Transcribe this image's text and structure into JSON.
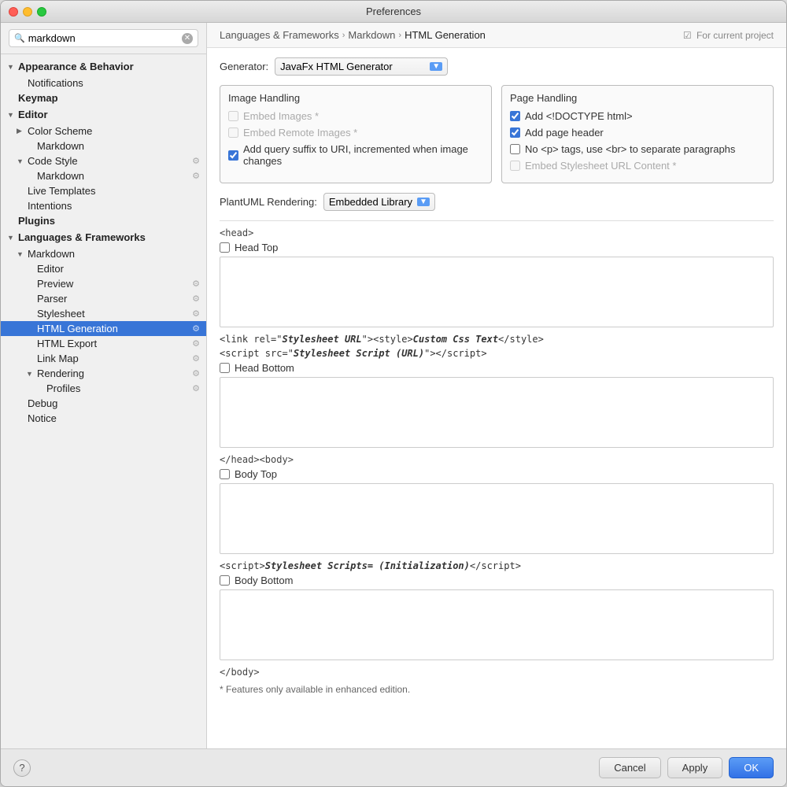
{
  "window": {
    "title": "Preferences"
  },
  "search": {
    "value": "markdown",
    "placeholder": "Search"
  },
  "sidebar": {
    "items": [
      {
        "id": "appearance",
        "label": "Appearance & Behavior",
        "level": 0,
        "type": "section-header",
        "arrow": "▼"
      },
      {
        "id": "notifications",
        "label": "Notifications",
        "level": 1,
        "type": "item"
      },
      {
        "id": "keymap",
        "label": "Keymap",
        "level": 0,
        "type": "bold-item"
      },
      {
        "id": "editor",
        "label": "Editor",
        "level": 0,
        "type": "section-header",
        "arrow": "▼"
      },
      {
        "id": "color-scheme",
        "label": "Color Scheme",
        "level": 1,
        "type": "item",
        "arrow": "▶"
      },
      {
        "id": "color-scheme-markdown",
        "label": "Markdown",
        "level": 2,
        "type": "item"
      },
      {
        "id": "code-style",
        "label": "Code Style",
        "level": 1,
        "type": "item",
        "arrow": "▼",
        "has_icon": true
      },
      {
        "id": "code-style-markdown",
        "label": "Markdown",
        "level": 2,
        "type": "item",
        "has_icon": true
      },
      {
        "id": "live-templates",
        "label": "Live Templates",
        "level": 1,
        "type": "item"
      },
      {
        "id": "intentions",
        "label": "Intentions",
        "level": 1,
        "type": "item"
      },
      {
        "id": "plugins",
        "label": "Plugins",
        "level": 0,
        "type": "bold-item"
      },
      {
        "id": "languages",
        "label": "Languages & Frameworks",
        "level": 0,
        "type": "section-header",
        "arrow": "▼"
      },
      {
        "id": "markdown",
        "label": "Markdown",
        "level": 1,
        "type": "item",
        "arrow": "▼"
      },
      {
        "id": "markdown-editor",
        "label": "Editor",
        "level": 2,
        "type": "item"
      },
      {
        "id": "markdown-preview",
        "label": "Preview",
        "level": 2,
        "type": "item",
        "has_icon": true
      },
      {
        "id": "markdown-parser",
        "label": "Parser",
        "level": 2,
        "type": "item",
        "has_icon": true
      },
      {
        "id": "markdown-stylesheet",
        "label": "Stylesheet",
        "level": 2,
        "type": "item",
        "has_icon": true
      },
      {
        "id": "html-generation",
        "label": "HTML Generation",
        "level": 2,
        "type": "active",
        "has_icon": true
      },
      {
        "id": "html-export",
        "label": "HTML Export",
        "level": 2,
        "type": "item",
        "has_icon": true
      },
      {
        "id": "link-map",
        "label": "Link Map",
        "level": 2,
        "type": "item",
        "has_icon": true
      },
      {
        "id": "rendering",
        "label": "Rendering",
        "level": 2,
        "type": "item",
        "arrow": "▼",
        "has_icon": true
      },
      {
        "id": "profiles",
        "label": "Profiles",
        "level": 3,
        "type": "item",
        "has_icon": true
      },
      {
        "id": "debug",
        "label": "Debug",
        "level": 1,
        "type": "item"
      },
      {
        "id": "notice",
        "label": "Notice",
        "level": 1,
        "type": "item"
      }
    ]
  },
  "breadcrumb": {
    "parts": [
      "Languages & Frameworks",
      "Markdown",
      "HTML Generation"
    ],
    "project_link": "For current project"
  },
  "content": {
    "generator_label": "Generator:",
    "generator_value": "JavaFx HTML Generator",
    "image_handling": {
      "title": "Image Handling",
      "embed_images_label": "Embed Images *",
      "embed_images_checked": false,
      "embed_images_disabled": true,
      "embed_remote_images_label": "Embed Remote Images *",
      "embed_remote_images_checked": false,
      "embed_remote_images_disabled": true,
      "add_query_suffix_label": "Add query suffix to URI, incremented when image changes",
      "add_query_suffix_checked": true
    },
    "page_handling": {
      "title": "Page Handling",
      "add_doctype_label": "Add <!DOCTYPE html>",
      "add_doctype_checked": true,
      "add_page_header_label": "Add page header",
      "add_page_header_checked": true,
      "no_p_tags_label": "No <p> tags, use <br> to separate paragraphs",
      "no_p_tags_checked": false,
      "embed_stylesheet_label": "Embed Stylesheet URL Content *",
      "embed_stylesheet_checked": false,
      "embed_stylesheet_disabled": true
    },
    "plantuml_label": "PlantUML Rendering:",
    "plantuml_value": "Embedded Library",
    "head_tag": "<head>",
    "head_top_label": "Head Top",
    "head_top_checked": false,
    "code_line1": "<link rel=\"Stylesheet URL\"><style>Custom Css Text</style>",
    "code_line2": "<script src=\"Stylesheet Script (URL)\"></script>",
    "head_bottom_label": "Head Bottom",
    "head_bottom_checked": false,
    "head_close_body_tag": "</head><body>",
    "body_top_label": "Body Top",
    "body_top_checked": false,
    "script_line": "<script>Stylesheet Scripts= (Initialization)</script>",
    "body_bottom_label": "Body Bottom",
    "body_bottom_checked": false,
    "body_close_tag": "</body>",
    "features_note": "* Features only available in enhanced edition."
  },
  "footer": {
    "cancel_label": "Cancel",
    "apply_label": "Apply",
    "ok_label": "OK",
    "help_label": "?"
  }
}
